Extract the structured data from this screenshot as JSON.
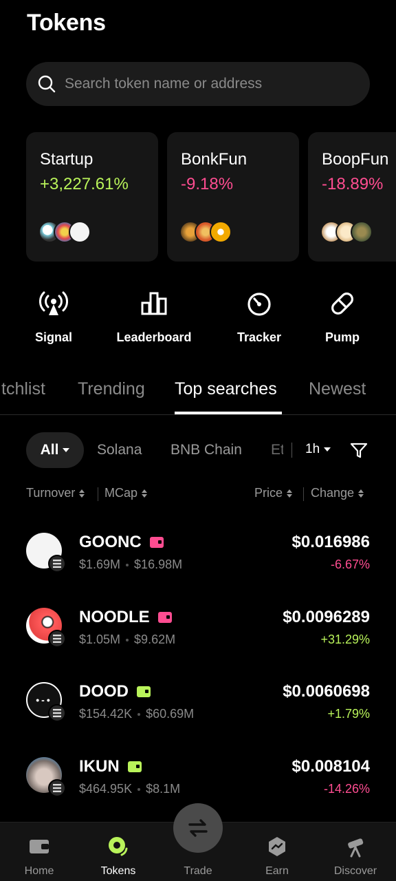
{
  "page": {
    "title": "Tokens"
  },
  "search": {
    "placeholder": "Search token name or address",
    "icon": "search-icon"
  },
  "categories": [
    {
      "name": "Startup",
      "change": "+3,227.61%",
      "direction": "up"
    },
    {
      "name": "BonkFun",
      "change": "-9.18%",
      "direction": "down"
    },
    {
      "name": "BoopFun",
      "change": "-18.89%",
      "direction": "down"
    }
  ],
  "quick_actions": [
    {
      "label": "Signal",
      "icon": "signal-icon"
    },
    {
      "label": "Leaderboard",
      "icon": "leaderboard-icon"
    },
    {
      "label": "Tracker",
      "icon": "tracker-icon"
    },
    {
      "label": "Pump",
      "icon": "pill-icon"
    }
  ],
  "tabs": [
    {
      "label": "tchlist",
      "active": false
    },
    {
      "label": "Trending",
      "active": false
    },
    {
      "label": "Top searches",
      "active": true
    },
    {
      "label": "Newest",
      "active": false
    }
  ],
  "chains": {
    "selected": "All",
    "items": [
      "Solana",
      "BNB Chain",
      "Et"
    ],
    "interval": "1h"
  },
  "sort_headers": {
    "turnover": "Turnover",
    "mcap": "MCap",
    "price": "Price",
    "change": "Change"
  },
  "tokens": [
    {
      "symbol": "GOONC",
      "turnover": "$1.69M",
      "mcap": "$16.98M",
      "price": "$0.016986",
      "change": "-6.67%",
      "direction": "down",
      "wallet_color": "#ff4d91"
    },
    {
      "symbol": "NOODLE",
      "turnover": "$1.05M",
      "mcap": "$9.62M",
      "price": "$0.0096289",
      "change": "+31.29%",
      "direction": "up",
      "wallet_color": "#ff4d91"
    },
    {
      "symbol": "DOOD",
      "turnover": "$154.42K",
      "mcap": "$60.69M",
      "price": "$0.0060698",
      "change": "+1.79%",
      "direction": "up",
      "wallet_color": "#b9f35a"
    },
    {
      "symbol": "IKUN",
      "turnover": "$464.95K",
      "mcap": "$8.1M",
      "price": "$0.008104",
      "change": "-14.26%",
      "direction": "down",
      "wallet_color": "#b9f35a"
    }
  ],
  "bottom_nav": [
    {
      "label": "Home",
      "icon": "wallet-icon",
      "active": false
    },
    {
      "label": "Tokens",
      "icon": "tokens-icon",
      "active": true
    },
    {
      "label": "Trade",
      "icon": "swap-icon",
      "active": false
    },
    {
      "label": "Earn",
      "icon": "earn-icon",
      "active": false
    },
    {
      "label": "Discover",
      "icon": "telescope-icon",
      "active": false
    }
  ],
  "colors": {
    "up": "#b9f35a",
    "down": "#ff4d91",
    "background": "#000000",
    "surface": "#161616"
  }
}
